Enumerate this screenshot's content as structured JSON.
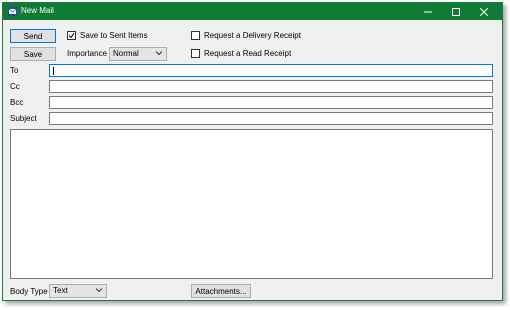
{
  "window": {
    "title": "New Mail",
    "controls": {
      "minimize": "minimize",
      "maximize": "maximize",
      "close": "close"
    }
  },
  "toolbar": {
    "send_label": "Send",
    "save_label": "Save",
    "save_to_sent_label": "Save to Sent Items",
    "save_to_sent_checked": true,
    "importance_label": "Importance :",
    "importance_value": "Normal",
    "delivery_receipt_label": "Request a Delivery Receipt",
    "delivery_receipt_checked": false,
    "read_receipt_label": "Request a Read Receipt",
    "read_receipt_checked": false
  },
  "fields": {
    "to_label": "To",
    "to_value": "",
    "cc_label": "Cc",
    "cc_value": "",
    "bcc_label": "Bcc",
    "bcc_value": "",
    "subject_label": "Subject",
    "subject_value": "",
    "body_value": ""
  },
  "footer": {
    "body_type_label": "Body Type",
    "body_type_value": "Text",
    "attachments_label": "Attachments..."
  },
  "colors": {
    "titlebar": "#0f7b35",
    "focus_border": "#0078d7",
    "window_bg": "#f0f0f0"
  },
  "icons": {
    "app": "mail-app-icon",
    "checkmark": "checkmark-icon",
    "dropdown": "chevron-down-icon"
  }
}
